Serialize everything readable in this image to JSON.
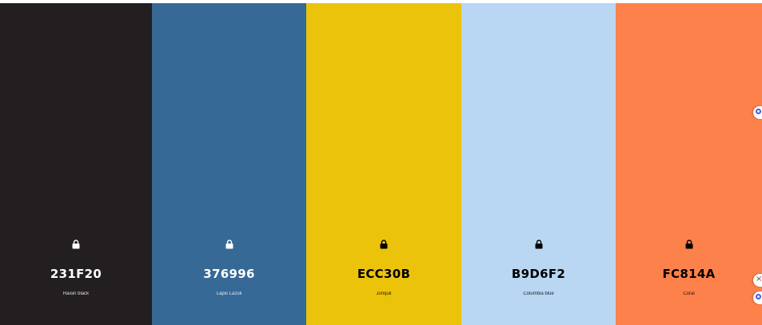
{
  "palette": {
    "swatches": [
      {
        "hex": "231F20",
        "name": "Raisin black",
        "bg": "#231F20",
        "fg": "#ffffff"
      },
      {
        "hex": "376996",
        "name": "Lapis Lazuli",
        "bg": "#376996",
        "fg": "#ffffff"
      },
      {
        "hex": "ECC30B",
        "name": "Jonquil",
        "bg": "#ECC30B",
        "fg": "#000000"
      },
      {
        "hex": "B9D6F2",
        "name": "Columbia blue",
        "bg": "#B9D6F2",
        "fg": "#000000"
      },
      {
        "hex": "FC814A",
        "name": "Coral",
        "bg": "#FC814A",
        "fg": "#000000"
      }
    ]
  },
  "side_tools": [
    {
      "icon": "color-picker-icon"
    },
    {
      "icon": "close-icon"
    },
    {
      "icon": "color-picker-icon"
    }
  ]
}
